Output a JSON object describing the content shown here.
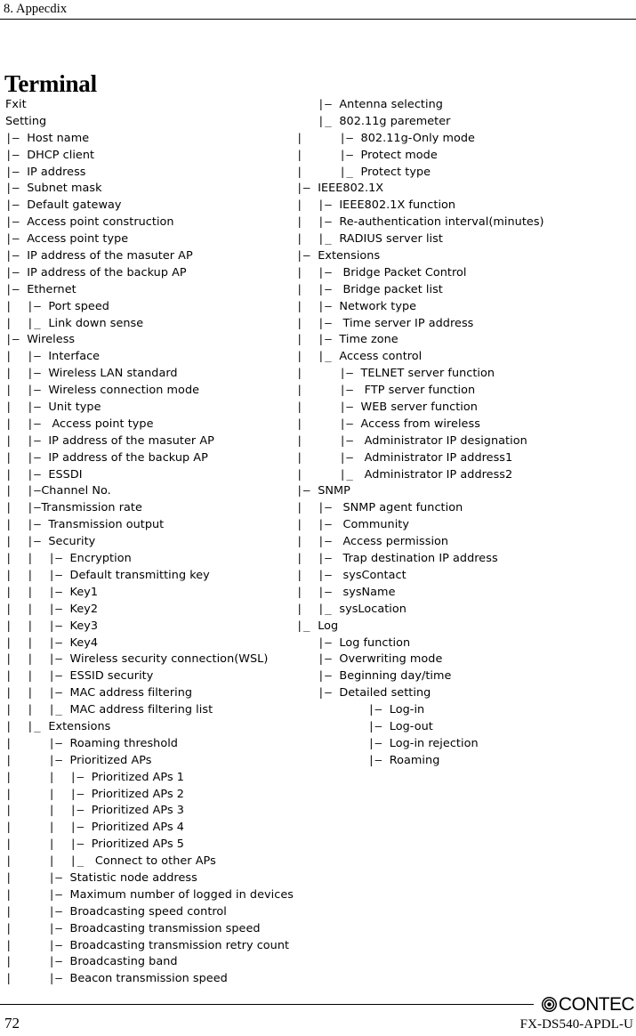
{
  "header": {
    "chapter_label": "8. Appecdix"
  },
  "section": {
    "title": "Terminal"
  },
  "footer": {
    "page_number": "72",
    "document_code": "FX-DS540-APDL-U",
    "brand_name": "CONTEC",
    "brand_mark_icon": "concentric-circles-logo-icon"
  },
  "menu_tree": {
    "left_column": [
      {
        "guides": "",
        "label": "Fxit"
      },
      {
        "guides": "",
        "label": "Setting"
      },
      {
        "guides": "|– ",
        "label": "Host name"
      },
      {
        "guides": "|– ",
        "label": "DHCP client"
      },
      {
        "guides": "|– ",
        "label": "IP address"
      },
      {
        "guides": "|– ",
        "label": "Subnet mask"
      },
      {
        "guides": "|– ",
        "label": "Default gateway"
      },
      {
        "guides": "|– ",
        "label": "Access point construction"
      },
      {
        "guides": "|– ",
        "label": "Access point type"
      },
      {
        "guides": "|– ",
        "label": "IP address of the masuter AP"
      },
      {
        "guides": "|– ",
        "label": "IP address of the backup AP"
      },
      {
        "guides": "|– ",
        "label": "Ethernet"
      },
      {
        "guides": "|  |– ",
        "label": "Port speed"
      },
      {
        "guides": "|  |_ ",
        "label": "Link down sense"
      },
      {
        "guides": "|– ",
        "label": "Wireless"
      },
      {
        "guides": "|  |– ",
        "label": "Interface"
      },
      {
        "guides": "|  |– ",
        "label": "Wireless LAN standard"
      },
      {
        "guides": "|  |– ",
        "label": "Wireless connection mode"
      },
      {
        "guides": "|  |– ",
        "label": "Unit type"
      },
      {
        "guides": "|  |– ",
        "label": " Access point type"
      },
      {
        "guides": "|  |– ",
        "label": "IP address of the masuter AP"
      },
      {
        "guides": "|  |– ",
        "label": "IP address of the backup AP"
      },
      {
        "guides": "|  |– ",
        "label": "ESSDI"
      },
      {
        "guides": "|  |–",
        "label": "Channel No."
      },
      {
        "guides": "|  |–",
        "label": "Transmission rate"
      },
      {
        "guides": "|  |– ",
        "label": "Transmission output"
      },
      {
        "guides": "|  |– ",
        "label": "Security"
      },
      {
        "guides": "|  |  |– ",
        "label": "Encryption"
      },
      {
        "guides": "|  |  |– ",
        "label": "Default transmitting key"
      },
      {
        "guides": "|  |  |– ",
        "label": "Key1"
      },
      {
        "guides": "|  |  |– ",
        "label": "Key2"
      },
      {
        "guides": "|  |  |– ",
        "label": "Key3"
      },
      {
        "guides": "|  |  |– ",
        "label": "Key4"
      },
      {
        "guides": "|  |  |– ",
        "label": "Wireless security connection(WSL)"
      },
      {
        "guides": "|  |  |– ",
        "label": "ESSID security"
      },
      {
        "guides": "|  |  |– ",
        "label": "MAC address filtering"
      },
      {
        "guides": "|  |  |_ ",
        "label": "MAC address filtering list"
      },
      {
        "guides": "|  |_ ",
        "label": "Extensions"
      },
      {
        "guides": "|     |– ",
        "label": "Roaming threshold"
      },
      {
        "guides": "|     |– ",
        "label": "Prioritized APs"
      },
      {
        "guides": "|     |  |– ",
        "label": "Prioritized APs 1"
      },
      {
        "guides": "|     |  |– ",
        "label": "Prioritized APs 2"
      },
      {
        "guides": "|     |  |– ",
        "label": "Prioritized APs 3"
      },
      {
        "guides": "|     |  |– ",
        "label": "Prioritized APs 4"
      },
      {
        "guides": "|     |  |– ",
        "label": "Prioritized APs 5"
      },
      {
        "guides": "|     |  |_ ",
        "label": " Connect to other APs"
      },
      {
        "guides": "|     |– ",
        "label": "Statistic node address"
      },
      {
        "guides": "|     |– ",
        "label": "Maximum number of logged in devices"
      },
      {
        "guides": "|     |– ",
        "label": "Broadcasting speed control"
      },
      {
        "guides": "|     |– ",
        "label": "Broadcasting transmission speed"
      },
      {
        "guides": "|     |– ",
        "label": "Broadcasting transmission retry count"
      },
      {
        "guides": "|     |– ",
        "label": "Broadcasting band"
      },
      {
        "guides": "|     |– ",
        "label": "Beacon transmission speed"
      }
    ],
    "right_column": [
      {
        "guides": "   |– ",
        "label": "Antenna selecting"
      },
      {
        "guides": "   |_ ",
        "label": "802.11g paremeter"
      },
      {
        "guides": "|     |– ",
        "label": "802.11g-Only mode"
      },
      {
        "guides": "|     |– ",
        "label": "Protect mode"
      },
      {
        "guides": "|     |_ ",
        "label": "Protect type"
      },
      {
        "guides": "|– ",
        "label": "IEEE802.1X"
      },
      {
        "guides": "|  |– ",
        "label": "IEEE802.1X function"
      },
      {
        "guides": "|  |– ",
        "label": "Re-authentication interval(minutes)"
      },
      {
        "guides": "|  |_ ",
        "label": "RADIUS server list"
      },
      {
        "guides": "|– ",
        "label": "Extensions"
      },
      {
        "guides": "|  |– ",
        "label": " Bridge Packet Control"
      },
      {
        "guides": "|  |– ",
        "label": " Bridge packet list"
      },
      {
        "guides": "|  |– ",
        "label": "Network type"
      },
      {
        "guides": "|  |– ",
        "label": " Time server IP address"
      },
      {
        "guides": "|  |– ",
        "label": "Time zone"
      },
      {
        "guides": "|  |_ ",
        "label": "Access control"
      },
      {
        "guides": "|     |– ",
        "label": "TELNET server function"
      },
      {
        "guides": "|     |– ",
        "label": " FTP server function"
      },
      {
        "guides": "|     |– ",
        "label": "WEB server function"
      },
      {
        "guides": "|     |– ",
        "label": "Access from wireless"
      },
      {
        "guides": "|     |– ",
        "label": " Administrator IP designation"
      },
      {
        "guides": "|     |– ",
        "label": " Administrator IP address1"
      },
      {
        "guides": "|     |_ ",
        "label": " Administrator IP address2"
      },
      {
        "guides": "|– ",
        "label": "SNMP"
      },
      {
        "guides": "|  |– ",
        "label": " SNMP agent function"
      },
      {
        "guides": "|  |– ",
        "label": " Community"
      },
      {
        "guides": "|  |– ",
        "label": " Access permission"
      },
      {
        "guides": "|  |– ",
        "label": " Trap destination IP address"
      },
      {
        "guides": "|  |– ",
        "label": " sysContact"
      },
      {
        "guides": "|  |– ",
        "label": " sysName"
      },
      {
        "guides": "|  |_ ",
        "label": "sysLocation"
      },
      {
        "guides": "|_ ",
        "label": "Log"
      },
      {
        "guides": "   |– ",
        "label": "Log function"
      },
      {
        "guides": "   |– ",
        "label": "Overwriting mode"
      },
      {
        "guides": "   |– ",
        "label": "Beginning day/time"
      },
      {
        "guides": "   |– ",
        "label": "Detailed setting"
      },
      {
        "guides": "          |– ",
        "label": "Log-in"
      },
      {
        "guides": "          |– ",
        "label": "Log-out"
      },
      {
        "guides": "          |– ",
        "label": "Log-in rejection"
      },
      {
        "guides": "          |– ",
        "label": "Roaming"
      }
    ]
  }
}
